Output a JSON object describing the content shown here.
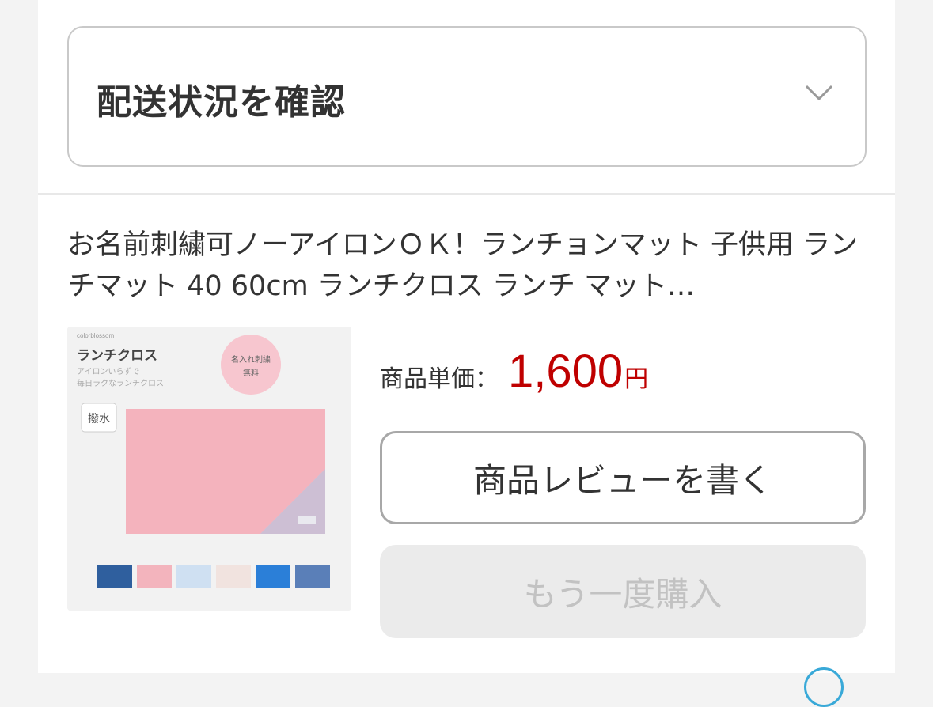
{
  "shipping": {
    "title": "配送状況を確認",
    "chevron_icon": "chevron-down-icon"
  },
  "product": {
    "name": "お名前刺繍可ノーアイロンＯＫ！ランチョンマット 子供用 ランチマット 40 60cm ランチクロス ランチ マット…",
    "thumbnail": {
      "brand": "colorblossom",
      "heading": "ランチクロス",
      "subtext_line1": "アイロンいらずで",
      "subtext_line2": "毎日ラクなランチクロス",
      "badge_line1": "名入れ刺繍",
      "badge_line2": "無料",
      "water_label": "撥水",
      "swatch_colors": [
        "#2f5f9e",
        "#f3b4bd",
        "#cfe0f2",
        "#f1e3df",
        "#2b7fd8",
        "#5a7fb8"
      ]
    },
    "price_label": "商品単価：",
    "price_value": "1,600",
    "price_unit": "円"
  },
  "buttons": {
    "review": "商品レビューを書く",
    "rebuy": "もう一度購入"
  },
  "colors": {
    "price": "#bf0000",
    "border": "#c9c9c9",
    "disabled_bg": "#ebebeb",
    "disabled_text": "#c2c2c2"
  }
}
